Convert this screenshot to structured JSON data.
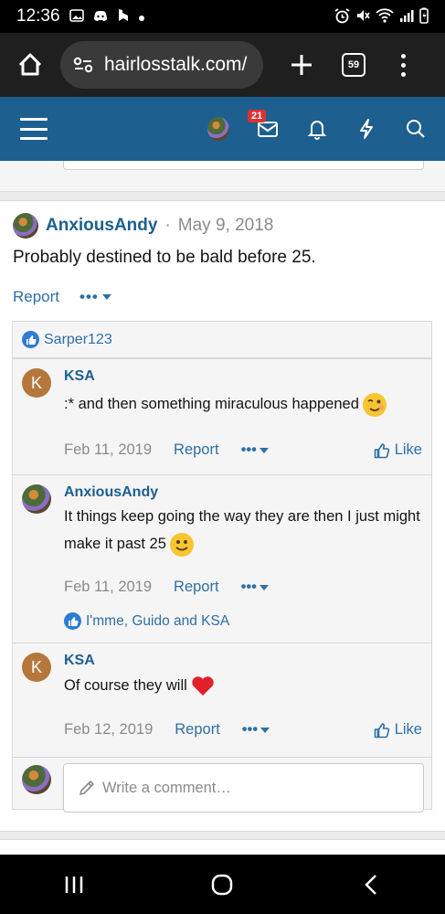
{
  "status_bar": {
    "time": "12:36",
    "icons": [
      "gallery-icon",
      "discord-icon",
      "b-app-icon",
      "dot-icon",
      "alarm-icon",
      "mute-icon",
      "wifi-icon",
      "signal-icon",
      "battery-icon"
    ]
  },
  "browser": {
    "url": "hairlosstalk.com/",
    "tab_count": "59"
  },
  "header": {
    "notification_count": "21"
  },
  "post": {
    "author": "AnxiousAndy",
    "separator": "·",
    "date": "May 9, 2018",
    "body": "Probably destined to be bald before 25.",
    "report_label": "Report",
    "more_label": "•••"
  },
  "reactions": {
    "users": "Sarper123"
  },
  "comments": [
    {
      "author": "KSA",
      "avatar_letter": "K",
      "text": ":* and then something miraculous happened",
      "emoji": "wink-emoji",
      "date": "Feb 11, 2019",
      "report_label": "Report",
      "more_label": "•••",
      "like_label": "Like"
    },
    {
      "author": "AnxiousAndy",
      "text": "It things keep going the way they are then I just might make it past 25",
      "emoji": "smile-emoji",
      "date": "Feb 11, 2019",
      "report_label": "Report",
      "more_label": "•••",
      "reactions": "I'mme, Guido and KSA"
    },
    {
      "author": "KSA",
      "avatar_letter": "K",
      "text": "Of course they will",
      "emoji": "heart-emoji",
      "date": "Feb 12, 2019",
      "report_label": "Report",
      "more_label": "•••",
      "like_label": "Like"
    }
  ],
  "comment_box": {
    "placeholder": "Write a comment…"
  },
  "colors": {
    "brand": "#1d5f8f",
    "link": "#2f6fa5",
    "badge": "#e03030",
    "like_blue": "#2d7dd2",
    "heart": "#e0202a"
  }
}
